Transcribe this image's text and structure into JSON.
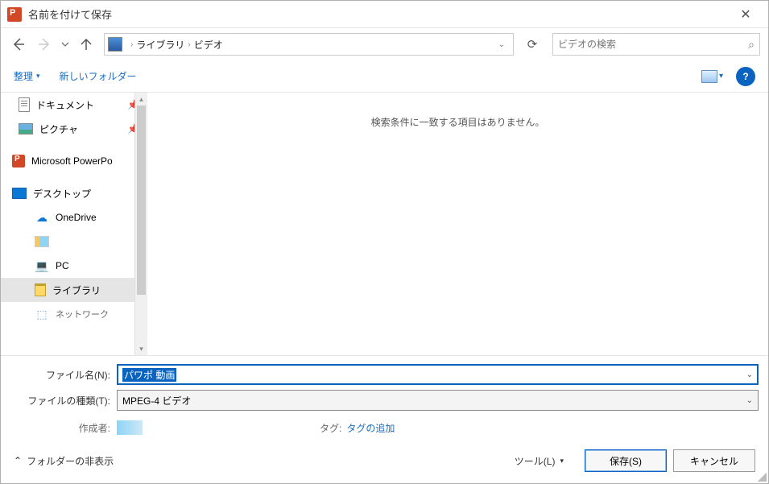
{
  "window": {
    "title": "名前を付けて保存"
  },
  "nav": {
    "breadcrumb": {
      "part1": "ライブラリ",
      "part2": "ビデオ"
    },
    "search_placeholder": "ビデオの検索"
  },
  "toolbar": {
    "organize": "整理",
    "new_folder": "新しいフォルダー"
  },
  "sidebar": {
    "documents": "ドキュメント",
    "pictures": "ピクチャ",
    "powerpoint": "Microsoft PowerPo",
    "desktop": "デスクトップ",
    "onedrive": "OneDrive",
    "user": "",
    "pc": "PC",
    "library": "ライブラリ",
    "network": "ネットワーク"
  },
  "content": {
    "empty": "検索条件に一致する項目はありません。"
  },
  "form": {
    "filename_label": "ファイル名(N):",
    "filename_value": "パワポ 動画",
    "filetype_label": "ファイルの種類(T):",
    "filetype_value": "MPEG-4 ビデオ",
    "author_label": "作成者:",
    "tags_label": "タグ:",
    "tags_link": "タグの追加"
  },
  "footer": {
    "hide_folders": "フォルダーの非表示",
    "tools": "ツール(L)",
    "save": "保存(S)",
    "cancel": "キャンセル"
  }
}
